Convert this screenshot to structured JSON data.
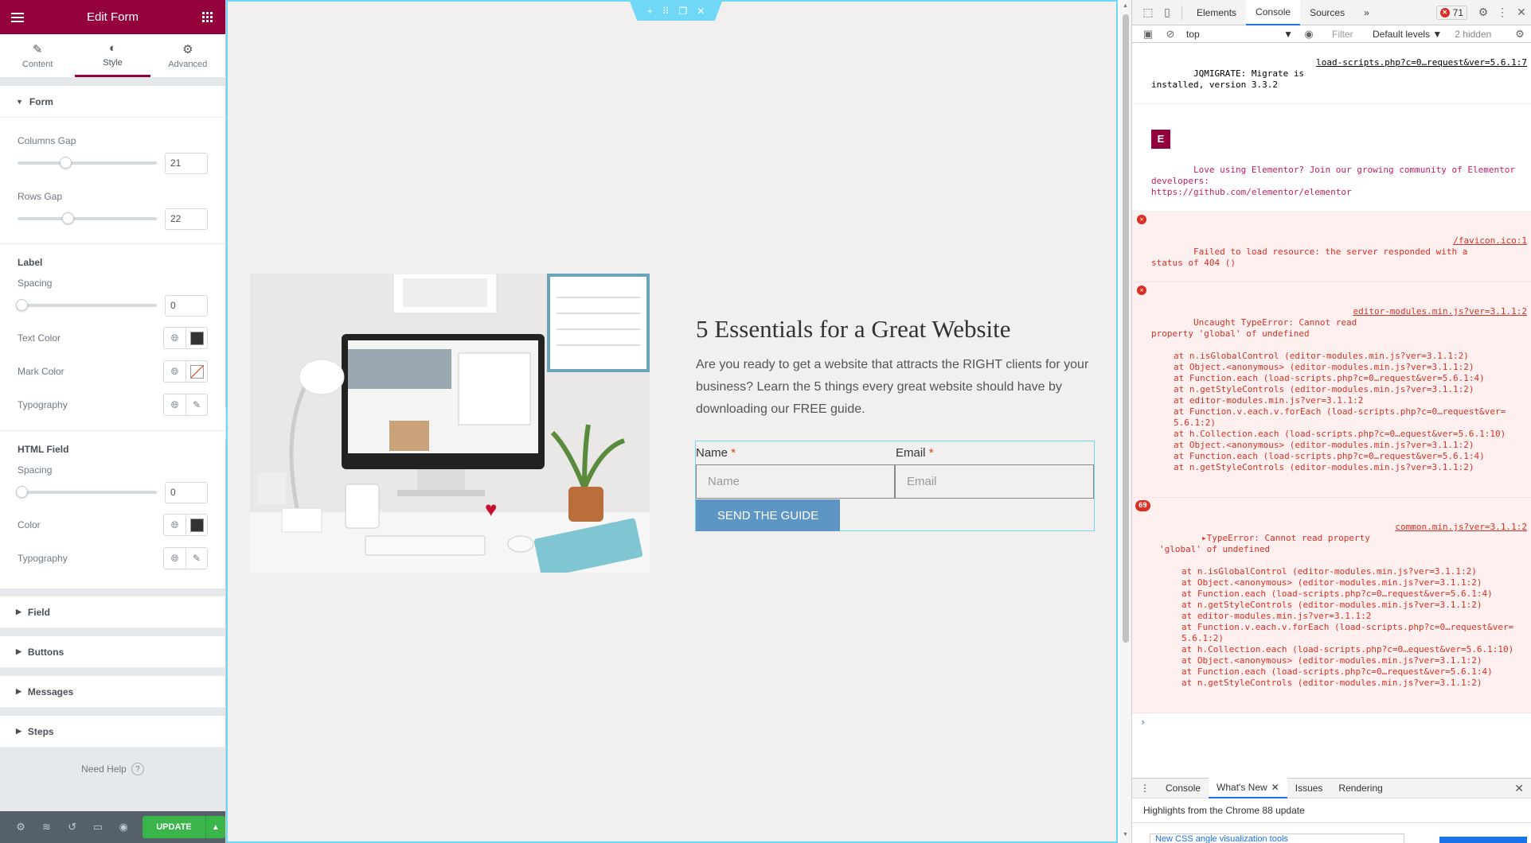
{
  "panel": {
    "header_title": "Edit Form",
    "tabs": [
      {
        "label": "Content",
        "icon": "pencil-icon"
      },
      {
        "label": "Style",
        "icon": "half-circle-icon"
      },
      {
        "label": "Advanced",
        "icon": "gear-icon"
      }
    ],
    "form_section": {
      "title": "Form",
      "columns_gap_label": "Columns Gap",
      "columns_gap_value": "21",
      "columns_gap_level": 0.21,
      "rows_gap_label": "Rows Gap",
      "rows_gap_value": "22",
      "rows_gap_level": 0.22,
      "label_heading": "Label",
      "label_spacing_label": "Spacing",
      "label_spacing_value": "0",
      "text_color_label": "Text Color",
      "text_color": "#333333",
      "mark_color_label": "Mark Color",
      "typography_label": "Typography",
      "html_field_heading": "HTML Field",
      "html_spacing_label": "Spacing",
      "html_spacing_value": "0",
      "html_color_label": "Color",
      "html_color": "#333333",
      "html_typography_label": "Typography"
    },
    "collapsed_sections": [
      "Field",
      "Buttons",
      "Messages",
      "Steps"
    ],
    "need_help": "Need Help",
    "update_label": "UPDATE"
  },
  "preview": {
    "title": "5 Essentials for a Great Website",
    "text": "Are you ready to get a website that attracts the RIGHT clients for your business? Learn the 5 things every great website should have by downloading our FREE guide.",
    "name_label": "Name",
    "email_label": "Email",
    "required_mark": "*",
    "name_placeholder": "Name",
    "email_placeholder": "Email",
    "button_label": "SEND THE GUIDE",
    "button_color": "#5d95c4",
    "accent": "#71d7f7"
  },
  "devtools": {
    "tabs": [
      "Elements",
      "Console",
      "Sources"
    ],
    "active_tab": "Console",
    "more": "»",
    "error_count": "71",
    "context": "top",
    "filter_placeholder": "Filter",
    "levels": "Default levels",
    "hidden": "2 hidden",
    "messages": [
      {
        "type": "log",
        "text": "JQMIGRATE: Migrate is\ninstalled, version 3.3.2",
        "source": "load-scripts.php?c=0…request&ver=5.6.1:7"
      },
      {
        "type": "info",
        "text": "Love using Elementor? Join our growing community of Elementor\ndevelopers:\nhttps://github.com/elementor/elementor",
        "source": ""
      },
      {
        "type": "error",
        "text": "Failed to load resource: the server responded with a\nstatus of 404 ()",
        "source": "/favicon.ico:1"
      },
      {
        "type": "error",
        "text": "Uncaught TypeError: Cannot read\nproperty 'global' of undefined",
        "source": "editor-modules.min.js?ver=3.1.1:2",
        "stack": [
          "at n.isGlobalControl (editor-modules.min.js?ver=3.1.1:2)",
          "at Object.<anonymous> (editor-modules.min.js?ver=3.1.1:2)",
          "at Function.each (load-scripts.php?c=0…request&ver=5.6.1:4)",
          "at n.getStyleControls (editor-modules.min.js?ver=3.1.1:2)",
          "at editor-modules.min.js?ver=3.1.1:2",
          "at Function.v.each.v.forEach (load-scripts.php?c=0…request&ver=",
          "5.6.1:2)",
          "at h.Collection.each (load-scripts.php?c=0…equest&ver=5.6.1:10)",
          "at Object.<anonymous> (editor-modules.min.js?ver=3.1.1:2)",
          "at Function.each (load-scripts.php?c=0…request&ver=5.6.1:4)",
          "at n.getStyleControls (editor-modules.min.js?ver=3.1.1:2)"
        ]
      },
      {
        "type": "error",
        "repeat": "69",
        "text": "▸TypeError: Cannot read property\n'global' of undefined",
        "source": "common.min.js?ver=3.1.1:2",
        "stack": [
          "at n.isGlobalControl (editor-modules.min.js?ver=3.1.1:2)",
          "at Object.<anonymous> (editor-modules.min.js?ver=3.1.1:2)",
          "at Function.each (load-scripts.php?c=0…request&ver=5.6.1:4)",
          "at n.getStyleControls (editor-modules.min.js?ver=3.1.1:2)",
          "at editor-modules.min.js?ver=3.1.1:2",
          "at Function.v.each.v.forEach (load-scripts.php?c=0…request&ver=",
          "5.6.1:2)",
          "at h.Collection.each (load-scripts.php?c=0…equest&ver=5.6.1:10)",
          "at Object.<anonymous> (editor-modules.min.js?ver=3.1.1:2)",
          "at Function.each (load-scripts.php?c=0…request&ver=5.6.1:4)",
          "at n.getStyleControls (editor-modules.min.js?ver=3.1.1:2)"
        ]
      }
    ],
    "drawer_tabs": [
      "Console",
      "What's New",
      "Issues",
      "Rendering"
    ],
    "drawer_active": "What's New",
    "drawer_heading": "Highlights from the Chrome 88 update",
    "drawer_card": "New CSS angle visualization tools"
  }
}
